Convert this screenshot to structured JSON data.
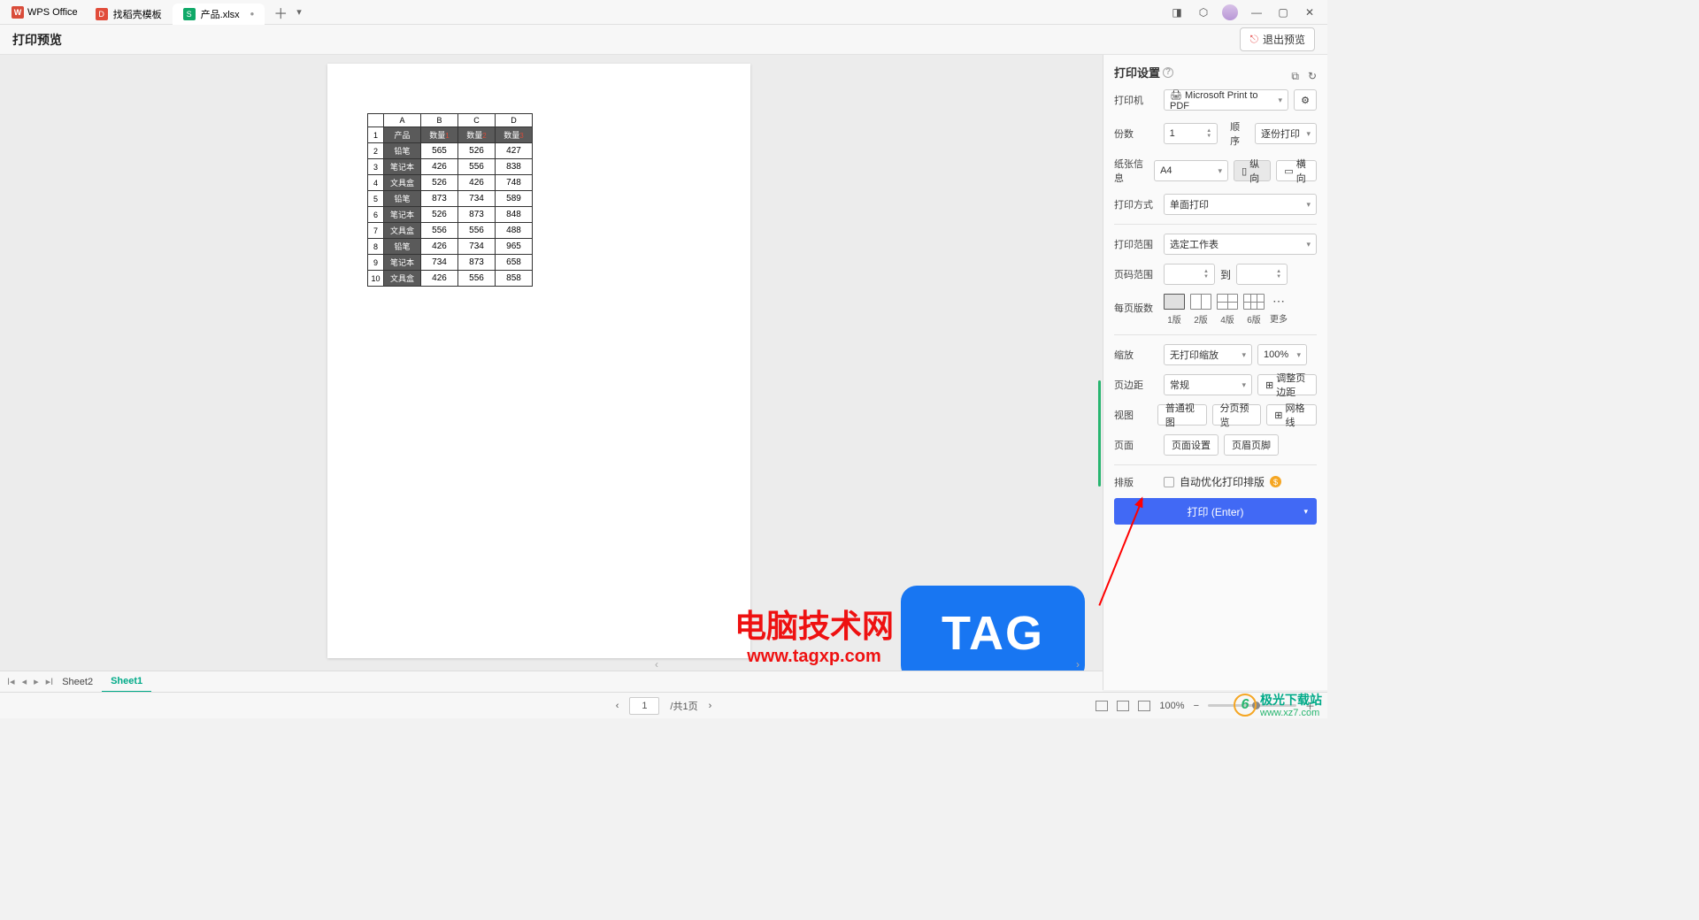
{
  "titlebar": {
    "app_label": "WPS Office",
    "tab1_label": "找稻壳模板",
    "tab2_label": "产品.xlsx"
  },
  "toolbar": {
    "page_title": "打印预览",
    "exit_label": "退出预览"
  },
  "table": {
    "cols": [
      "A",
      "B",
      "C",
      "D"
    ],
    "headers": [
      "产品",
      "数量",
      "数量",
      "数量"
    ],
    "header_sup": [
      "",
      "1",
      "2",
      "3"
    ],
    "rownums": [
      "1",
      "2",
      "3",
      "4",
      "5",
      "6",
      "7",
      "8",
      "9",
      "10"
    ],
    "rows": [
      [
        "产品",
        "数量1",
        "数量2",
        "数量3"
      ],
      [
        "铅笔",
        "565",
        "526",
        "427"
      ],
      [
        "笔记本",
        "426",
        "556",
        "838"
      ],
      [
        "文具盒",
        "526",
        "426",
        "748"
      ],
      [
        "铅笔",
        "873",
        "734",
        "589"
      ],
      [
        "笔记本",
        "526",
        "873",
        "848"
      ],
      [
        "文具盒",
        "556",
        "556",
        "488"
      ],
      [
        "铅笔",
        "426",
        "734",
        "965"
      ],
      [
        "笔记本",
        "734",
        "873",
        "658"
      ],
      [
        "文具盒",
        "426",
        "556",
        "858"
      ]
    ]
  },
  "settings": {
    "title": "打印设置",
    "printer_label": "打印机",
    "printer_value": "Microsoft Print to PDF",
    "copies_label": "份数",
    "copies_value": "1",
    "order_label": "顺序",
    "order_value": "逐份打印",
    "paper_label": "纸张信息",
    "paper_value": "A4",
    "portrait": "纵向",
    "landscape": "横向",
    "mode_label": "打印方式",
    "mode_value": "单面打印",
    "range_label": "打印范围",
    "range_value": "选定工作表",
    "pagerange_label": "页码范围",
    "to_label": "到",
    "pps_label": "每页版数",
    "pps1": "1版",
    "pps2": "2版",
    "pps4": "4版",
    "pps6": "6版",
    "pps_more": "更多",
    "zoom_label": "缩放",
    "zoom_value": "无打印缩放",
    "zoom_pct": "100%",
    "margin_label": "页边距",
    "margin_value": "常规",
    "margin_adjust": "调整页边距",
    "view_label": "视图",
    "view_normal": "普通视图",
    "view_pagebreak": "分页预览",
    "view_grid": "网格线",
    "page_label": "页面",
    "page_setup": "页面设置",
    "page_headerfooter": "页眉页脚",
    "layout_label": "排版",
    "layout_auto": "自动优化打印排版",
    "print_btn": "打印 (Enter)"
  },
  "sheetbar": {
    "tab1": "Sheet2",
    "tab2": "Sheet1"
  },
  "statusbar": {
    "page_value": "1",
    "page_total": "/共1页",
    "zoom": "100%"
  },
  "watermark": {
    "cn": "电脑技术网",
    "url": "www.tagxp.com",
    "tag": "TAG"
  },
  "dl": {
    "cn": "极光下载站",
    "url": "www.xz7.com"
  },
  "chart_data": {
    "type": "table",
    "title": "产品.xlsx print preview table",
    "columns": [
      "产品",
      "数量1",
      "数量2",
      "数量3"
    ],
    "rows": [
      [
        "铅笔",
        565,
        526,
        427
      ],
      [
        "笔记本",
        426,
        556,
        838
      ],
      [
        "文具盒",
        526,
        426,
        748
      ],
      [
        "铅笔",
        873,
        734,
        589
      ],
      [
        "笔记本",
        526,
        873,
        848
      ],
      [
        "文具盒",
        556,
        556,
        488
      ],
      [
        "铅笔",
        426,
        734,
        965
      ],
      [
        "笔记本",
        734,
        873,
        658
      ],
      [
        "文具盒",
        426,
        556,
        858
      ]
    ]
  }
}
